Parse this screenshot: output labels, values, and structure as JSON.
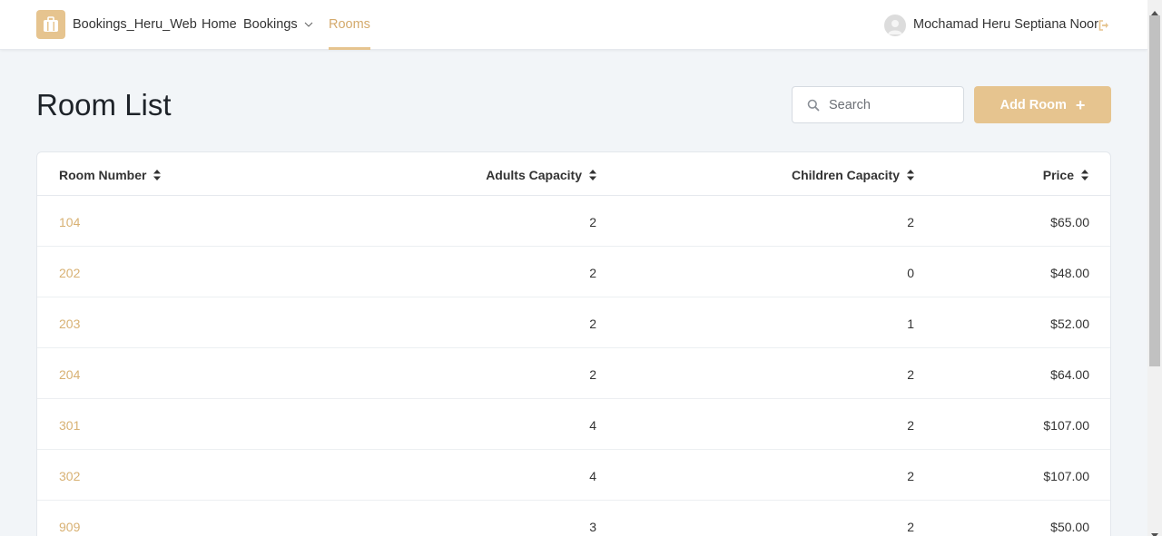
{
  "navbar": {
    "brand": "Bookings_Heru_Web",
    "home": "Home",
    "bookings": "Bookings",
    "rooms": "Rooms",
    "user_name": "Mochamad Heru Septiana Noor"
  },
  "page": {
    "title": "Room List"
  },
  "search": {
    "placeholder": "Search"
  },
  "actions": {
    "add_room": "Add Room",
    "add_icon": "+"
  },
  "table": {
    "headers": {
      "room_number": "Room Number",
      "adults": "Adults Capacity",
      "children": "Children Capacity",
      "price": "Price"
    },
    "rows": [
      {
        "room": "104",
        "adults": "2",
        "children": "2",
        "price": "$65.00"
      },
      {
        "room": "202",
        "adults": "2",
        "children": "0",
        "price": "$48.00"
      },
      {
        "room": "203",
        "adults": "2",
        "children": "1",
        "price": "$52.00"
      },
      {
        "room": "204",
        "adults": "2",
        "children": "2",
        "price": "$64.00"
      },
      {
        "room": "301",
        "adults": "4",
        "children": "2",
        "price": "$107.00"
      },
      {
        "room": "302",
        "adults": "4",
        "children": "2",
        "price": "$107.00"
      },
      {
        "room": "909",
        "adults": "3",
        "children": "2",
        "price": "$50.00"
      }
    ]
  },
  "colors": {
    "accent": "#e6c48f",
    "link": "#d8b173",
    "background": "#f2f5f8"
  },
  "icons": {
    "brand": "suitcase-icon",
    "dropdown": "chevron-down-icon",
    "avatar": "user-avatar-icon",
    "logout": "logout-icon",
    "search": "search-icon",
    "sort": "sort-icon"
  }
}
